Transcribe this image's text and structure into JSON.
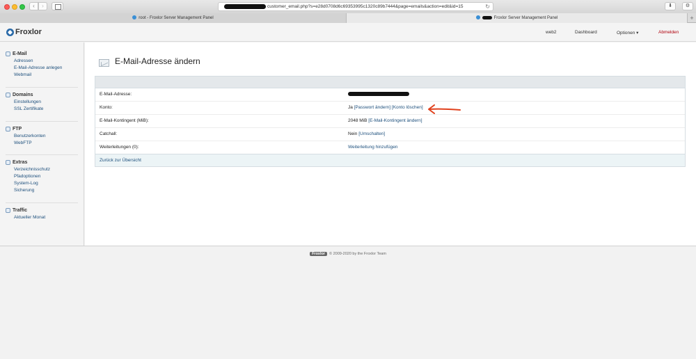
{
  "browser": {
    "url_text": "customer_email.php?s=e28d0708d6c69353995c1320c89b7444&page=emails&action=edit&id=15",
    "tabs": [
      {
        "label": "root - Froxlor Server Management Panel"
      },
      {
        "label": "Froxlor Server Management Panel"
      }
    ]
  },
  "header": {
    "brand": "Froxlor",
    "nav": {
      "server": "web2",
      "dashboard": "Dashboard",
      "options": "Optionen ▾",
      "logout": "Abmelden"
    }
  },
  "sidebar": {
    "sections": [
      {
        "title": "E-Mail",
        "items": [
          "Adressen",
          "E-Mail-Adresse anlegen",
          "Webmail"
        ]
      },
      {
        "title": "Domains",
        "items": [
          "Einstellungen",
          "SSL Zertifikate"
        ]
      },
      {
        "title": "FTP",
        "items": [
          "Benutzerkonten",
          "WebFTP"
        ]
      },
      {
        "title": "Extras",
        "items": [
          "Verzeichnisschutz",
          "Pfadoptionen",
          "System-Log",
          "Sicherung"
        ]
      },
      {
        "title": "Traffic",
        "items": [
          "Aktueller Monat"
        ]
      }
    ]
  },
  "main": {
    "title": "E-Mail-Adresse ändern",
    "rows": [
      {
        "label": "E-Mail-Adresse:"
      },
      {
        "label": "Konto:",
        "value": "Ja",
        "links": [
          "[Passwort ändern]",
          "[Konto löschen]"
        ]
      },
      {
        "label": "E-Mail-Kontingent (MiB):",
        "value": "2048 MiB",
        "links": [
          "[E-Mail-Kontingent ändern]"
        ]
      },
      {
        "label": "Catchall:",
        "value": "Nein",
        "links": [
          "[Umschalten]"
        ]
      },
      {
        "label": "Weiterleitungen (0):",
        "links": [
          "Weiterleitung hinzufügen"
        ]
      }
    ],
    "back_link": "Zurück zur Übersicht"
  },
  "footer": {
    "badge": "Froxlor",
    "text": "© 2009-2020 by the Froxlor Team"
  },
  "colors": {
    "accent": "#1d4f7c",
    "logout": "#b0000d",
    "annotation": "#e0401c"
  }
}
